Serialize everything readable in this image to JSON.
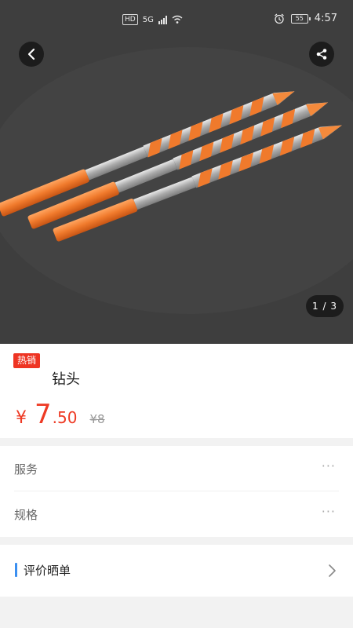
{
  "status_bar": {
    "left_hd": "HD",
    "left_net": "5G",
    "battery": "55",
    "time": "4:57"
  },
  "icons": {
    "back": "chevron-left-icon",
    "share": "share-icon",
    "alarm": "alarm-icon",
    "signal": "signal-icon",
    "wifi": "wifi-icon",
    "more": "more-dots-icon",
    "review_arrow": "chevron-right-icon"
  },
  "gallery": {
    "counter": "1 / 3"
  },
  "product": {
    "badge": "热销",
    "title": "钻头",
    "price_symbol": "¥",
    "price_int": "7",
    "price_dec": ".50",
    "original_price": "¥8"
  },
  "options": [
    {
      "label": "服务",
      "more": "···"
    },
    {
      "label": "规格",
      "more": "···"
    }
  ],
  "review": {
    "label": "评价晒单"
  },
  "colors": {
    "accent": "#ee3a24",
    "badge": "#ee3423",
    "review_bar": "#3b8ff0",
    "drill_orange": "#f07a2c"
  }
}
